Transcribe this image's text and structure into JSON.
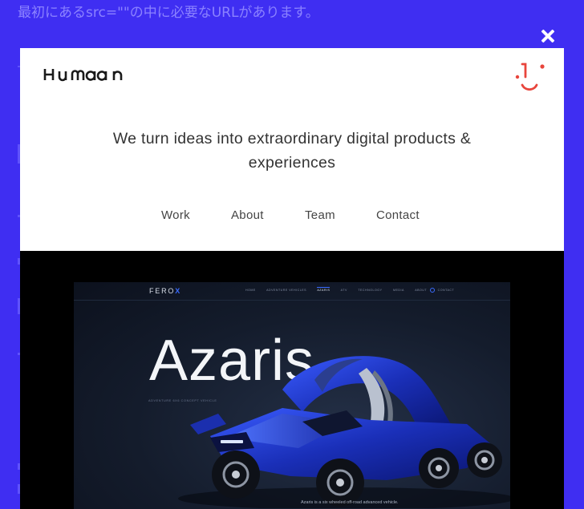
{
  "background": {
    "text": "最初にあるsrc=\"\"の中に必要なURLがあります。"
  },
  "modal": {
    "close_label": "×",
    "logo_text": "HUMAAN",
    "logo_icon": "smiley-face-icon",
    "tagline": "We turn ideas into extraordinary digital products & experiences",
    "nav": [
      "Work",
      "About",
      "Team",
      "Contact"
    ],
    "colors": {
      "accent": "#e8453c",
      "page_background": "#3f2ef2",
      "header_background": "#ffffff",
      "media_background": "#000000"
    }
  },
  "preview": {
    "brand": "FEROX",
    "nav_items": [
      "HOME",
      "ADVENTURE VEHICLES",
      "AZARIS",
      "ATV",
      "TECHNOLOGY",
      "MEDIA",
      "ABOUT",
      "CONTACT"
    ],
    "active_item": "AZARIS",
    "hero_title": "Azaris",
    "hero_subtitle": "ADVENTURE 6X6 CONCEPT VEHICLE",
    "caption": "Azaris is a six wheeled off-road advanced vehicle."
  }
}
